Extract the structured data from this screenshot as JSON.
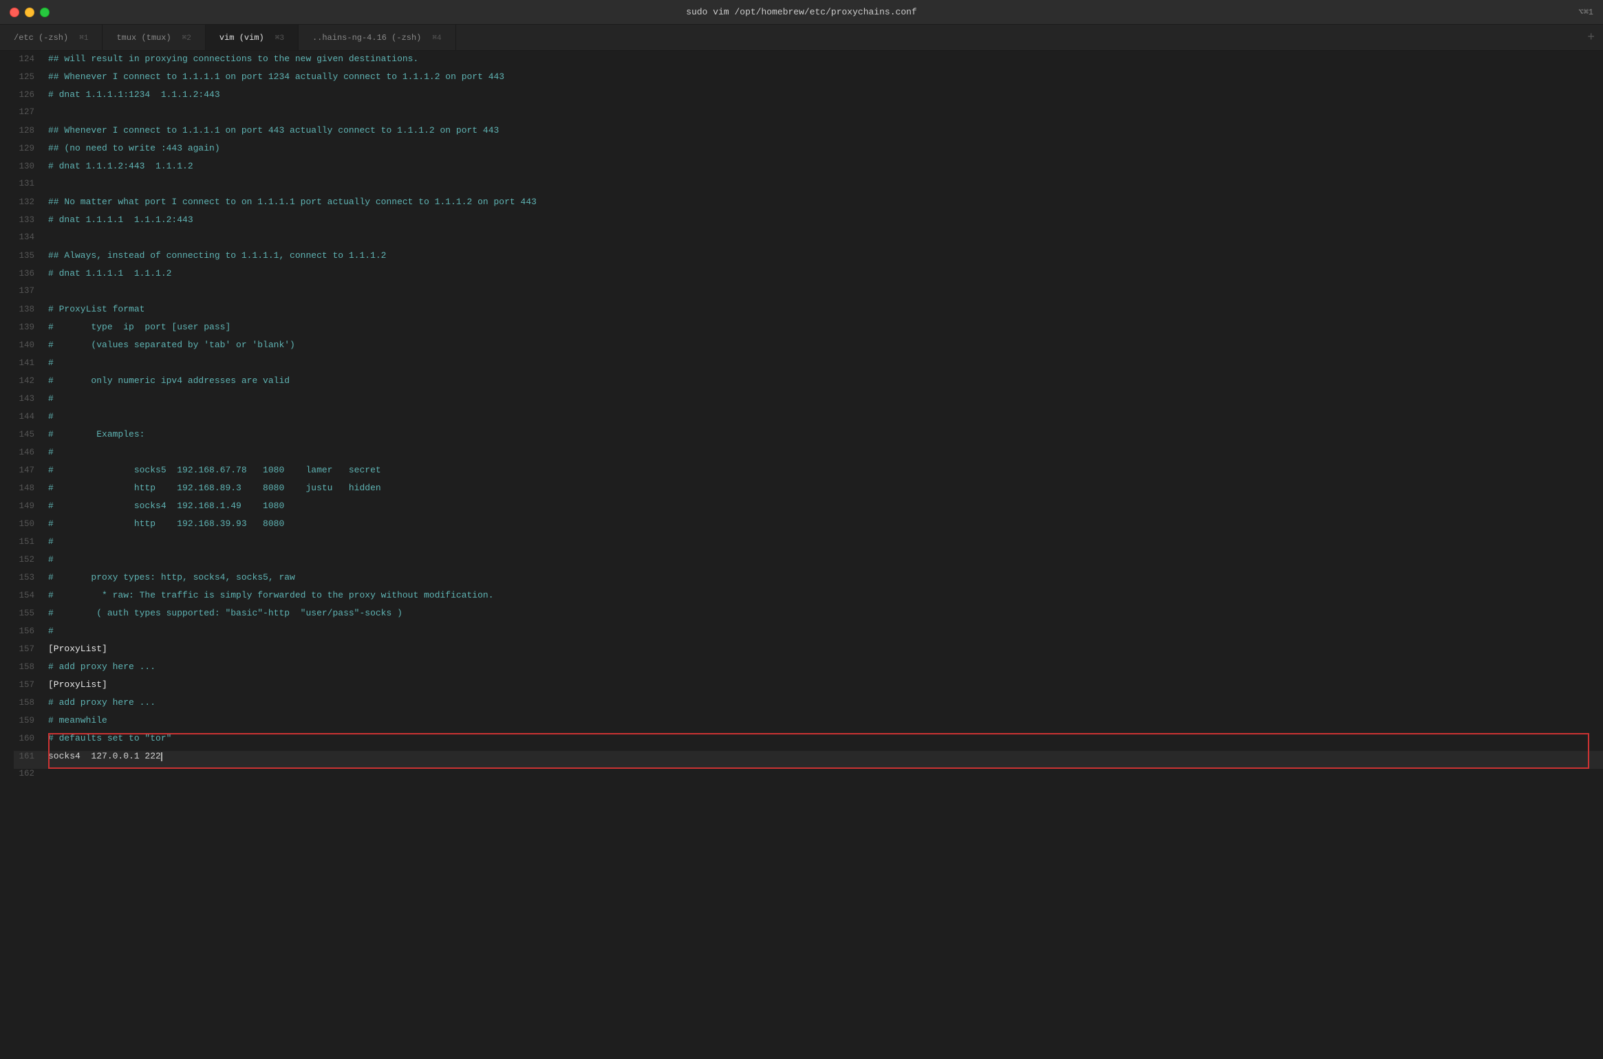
{
  "titlebar": {
    "title": "sudo vim /opt/homebrew/etc/proxychains.conf",
    "shortcut": "⌥⌘1"
  },
  "tabs": [
    {
      "id": "tab1",
      "label": "/etc (-zsh)",
      "shortcut": "⌘1",
      "active": false
    },
    {
      "id": "tab2",
      "label": "tmux (tmux)",
      "shortcut": "⌘2",
      "active": false
    },
    {
      "id": "tab3",
      "label": "vim (vim)",
      "shortcut": "⌘3",
      "active": true
    },
    {
      "id": "tab4",
      "label": "..hains-ng-4.16 (-zsh)",
      "shortcut": "⌘4",
      "active": false
    }
  ],
  "lines": [
    {
      "num": "124",
      "text": "## will result in proxying connections to the new given destinations.",
      "type": "comment"
    },
    {
      "num": "125",
      "text": "## Whenever I connect to 1.1.1.1 on port 1234 actually connect to 1.1.1.2 on port 443",
      "type": "comment"
    },
    {
      "num": "126",
      "text": "# dnat 1.1.1.1:1234  1.1.1.2:443",
      "type": "comment"
    },
    {
      "num": "127",
      "text": "",
      "type": "normal"
    },
    {
      "num": "128",
      "text": "## Whenever I connect to 1.1.1.1 on port 443 actually connect to 1.1.1.2 on port 443",
      "type": "comment"
    },
    {
      "num": "129",
      "text": "## (no need to write :443 again)",
      "type": "comment"
    },
    {
      "num": "130",
      "text": "# dnat 1.1.1.2:443  1.1.1.2",
      "type": "comment"
    },
    {
      "num": "131",
      "text": "",
      "type": "normal"
    },
    {
      "num": "132",
      "text": "## No matter what port I connect to on 1.1.1.1 port actually connect to 1.1.1.2 on port 443",
      "type": "comment"
    },
    {
      "num": "133",
      "text": "# dnat 1.1.1.1  1.1.1.2:443",
      "type": "comment"
    },
    {
      "num": "134",
      "text": "",
      "type": "normal"
    },
    {
      "num": "135",
      "text": "## Always, instead of connecting to 1.1.1.1, connect to 1.1.1.2",
      "type": "comment"
    },
    {
      "num": "136",
      "text": "# dnat 1.1.1.1  1.1.1.2",
      "type": "comment"
    },
    {
      "num": "137",
      "text": "",
      "type": "normal"
    },
    {
      "num": "138",
      "text": "# ProxyList format",
      "type": "comment"
    },
    {
      "num": "139",
      "text": "#       type  ip  port [user pass]",
      "type": "comment"
    },
    {
      "num": "140",
      "text": "#       (values separated by 'tab' or 'blank')",
      "type": "comment"
    },
    {
      "num": "141",
      "text": "#",
      "type": "comment"
    },
    {
      "num": "142",
      "text": "#       only numeric ipv4 addresses are valid",
      "type": "comment"
    },
    {
      "num": "143",
      "text": "#",
      "type": "comment"
    },
    {
      "num": "144",
      "text": "#",
      "type": "comment"
    },
    {
      "num": "145",
      "text": "#        Examples:",
      "type": "comment"
    },
    {
      "num": "146",
      "text": "#",
      "type": "comment"
    },
    {
      "num": "147",
      "text": "#               socks5  192.168.67.78   1080    lamer   secret",
      "type": "comment"
    },
    {
      "num": "148",
      "text": "#               http    192.168.89.3    8080    justu   hidden",
      "type": "comment"
    },
    {
      "num": "149",
      "text": "#               socks4  192.168.1.49    1080",
      "type": "comment"
    },
    {
      "num": "150",
      "text": "#               http    192.168.39.93   8080",
      "type": "comment"
    },
    {
      "num": "151",
      "text": "#",
      "type": "comment"
    },
    {
      "num": "152",
      "text": "#",
      "type": "comment"
    },
    {
      "num": "153",
      "text": "#       proxy types: http, socks4, socks5, raw",
      "type": "comment"
    },
    {
      "num": "154",
      "text": "#         * raw: The traffic is simply forwarded to the proxy without modification.",
      "type": "comment"
    },
    {
      "num": "155",
      "text": "#        ( auth types supported: \"basic\"-http  \"user/pass\"-socks )",
      "type": "comment"
    },
    {
      "num": "156",
      "text": "#",
      "type": "comment"
    },
    {
      "num": "157",
      "text": "[ProxyList]",
      "type": "section"
    },
    {
      "num": "158",
      "text": "# add proxy here ...",
      "type": "comment"
    },
    {
      "num": "157",
      "text": "[ProxyList]",
      "type": "section"
    },
    {
      "num": "158",
      "text": "# add proxy here ...",
      "type": "comment"
    },
    {
      "num": "159",
      "text": "# meanwhile",
      "type": "comment"
    },
    {
      "num": "160",
      "text": "# defaults set to \"tor\"",
      "type": "comment",
      "highlight": true
    },
    {
      "num": "161",
      "text": "socks4  127.0.0.1 222",
      "type": "normal",
      "highlight": true,
      "cursor": true
    },
    {
      "num": "162",
      "text": "",
      "type": "normal"
    }
  ]
}
